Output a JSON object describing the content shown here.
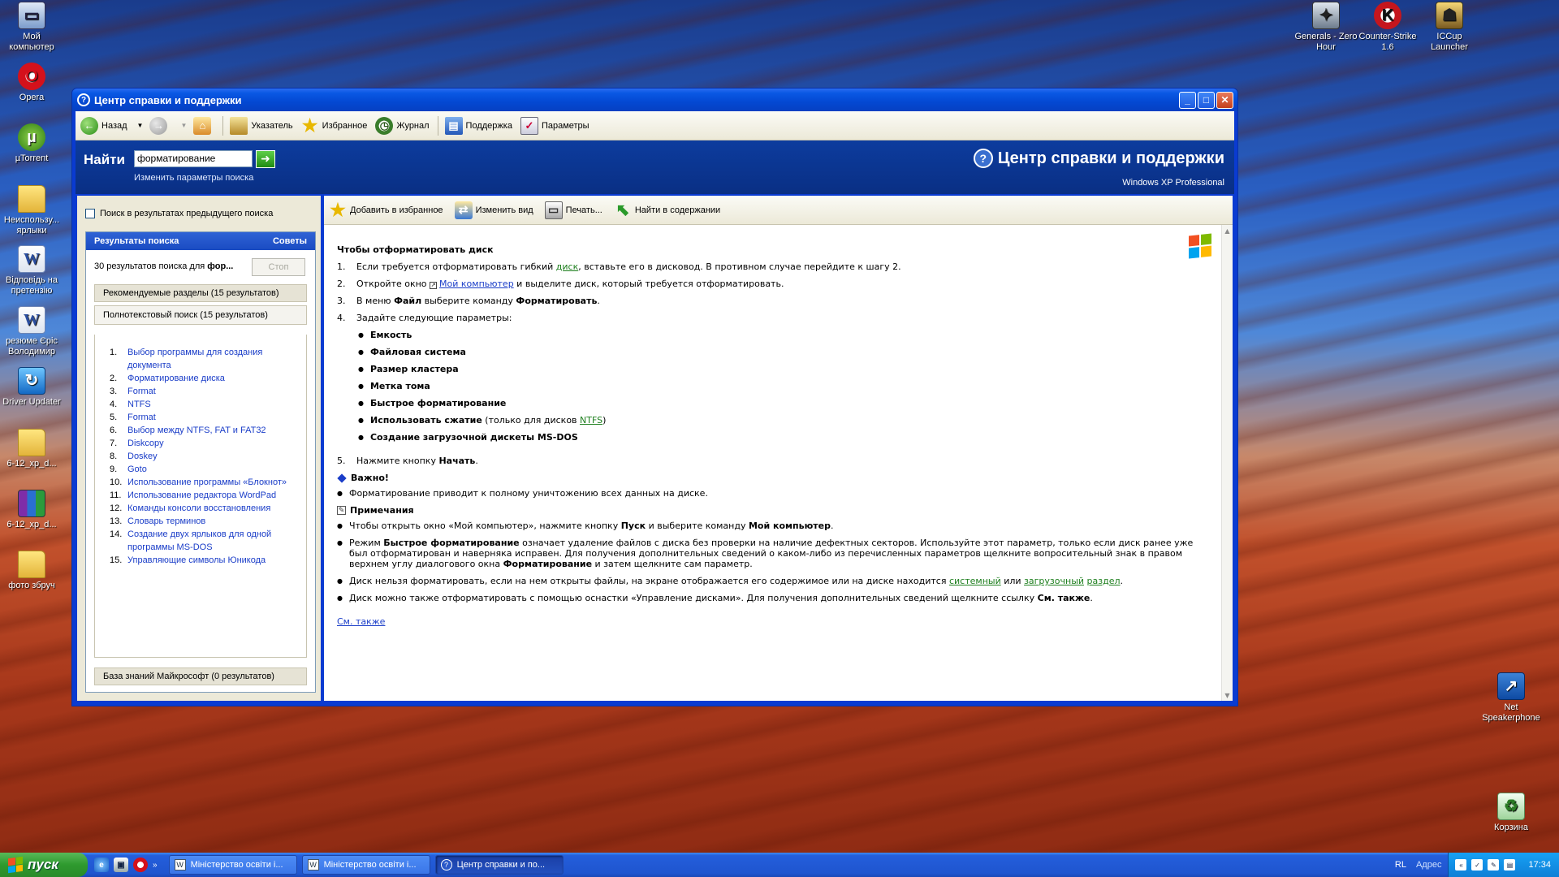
{
  "desktop": {
    "left_icons": [
      {
        "label": "Мой компьютер",
        "icon": "computer-icon"
      },
      {
        "label": "Opera",
        "icon": "opera-icon"
      },
      {
        "label": "µTorrent",
        "icon": "utorrent-icon"
      },
      {
        "label": "Неиспользу... ярлыки",
        "icon": "folder-icon"
      },
      {
        "label": "Відповідь на претензію",
        "icon": "word-document-icon"
      },
      {
        "label": "резюме Єріс Володимир",
        "icon": "word-document-icon"
      },
      {
        "label": "Driver Updater",
        "icon": "driver-updater-icon"
      },
      {
        "label": "6-12_xp_d...",
        "icon": "folder-icon"
      },
      {
        "label": "6-12_xp_d...",
        "icon": "winrar-archive-icon"
      },
      {
        "label": "фото збруч",
        "icon": "folder-icon"
      }
    ],
    "right_icons": [
      {
        "label": "Generals - Zero Hour",
        "icon": "generals-icon"
      },
      {
        "label": "Counter-Strike 1.6",
        "icon": "counter-strike-icon"
      },
      {
        "label": "ICCup Launcher",
        "icon": "iccup-icon"
      },
      {
        "label": "Net Speakerphone",
        "icon": "net-speakerphone-icon"
      },
      {
        "label": "Корзина",
        "icon": "recycle-bin-icon"
      }
    ]
  },
  "window": {
    "title": "Центр справки и поддержки",
    "toolbar": {
      "back": "Назад",
      "index": "Указатель",
      "favorites": "Избранное",
      "history": "Журнал",
      "support": "Поддержка",
      "options": "Параметры"
    },
    "header": {
      "find_label": "Найти",
      "search_value": "форматирование",
      "search_options": "Изменить параметры поиска",
      "title": "Центр справки и поддержки",
      "edition": "Windows XP Professional"
    },
    "left": {
      "checkbox_label": "Поиск в результатах предыдущего поиска",
      "results_title": "Результаты поиска",
      "tips": "Советы",
      "count_prefix": "30 результатов поиска для ",
      "count_query": "фор...",
      "stop_button": "Стоп",
      "cat_recommended": "Рекомендуемые разделы (15 результатов)",
      "cat_fulltext": "Полнотекстовый поиск (15 результатов)",
      "cat_kb": "База знаний Майкрософт (0 результатов)",
      "results": [
        {
          "n": "1.",
          "t": "Выбор программы для создания документа"
        },
        {
          "n": "2.",
          "t": "Форматирование диска"
        },
        {
          "n": "3.",
          "t": "Format"
        },
        {
          "n": "4.",
          "t": "NTFS"
        },
        {
          "n": "5.",
          "t": "Format"
        },
        {
          "n": "6.",
          "t": "Выбор между NTFS, FAT и FAT32"
        },
        {
          "n": "7.",
          "t": "Diskcopy"
        },
        {
          "n": "8.",
          "t": "Doskey"
        },
        {
          "n": "9.",
          "t": "Goto"
        },
        {
          "n": "10.",
          "t": "Использование программы «Блокнот»"
        },
        {
          "n": "11.",
          "t": "Использование редактора WordPad"
        },
        {
          "n": "12.",
          "t": "Команды консоли восстановления"
        },
        {
          "n": "13.",
          "t": "Словарь терминов"
        },
        {
          "n": "14.",
          "t": "Создание двух ярлыков для одной программы MS-DOS"
        },
        {
          "n": "15.",
          "t": "Управляющие символы Юникода"
        }
      ]
    },
    "cmdbar": {
      "add_fav": "Добавить в избранное",
      "change_view": "Изменить вид",
      "print": "Печать...",
      "find_contents": "Найти в содержании"
    },
    "article": {
      "title": "Чтобы отформатировать диск",
      "s1_n": "1.",
      "s1_a": "Если требуется отформатировать гибкий ",
      "s1_link": "диск",
      "s1_b": ", вставьте его в дисковод. В противном случае перейдите к шагу 2.",
      "s2_n": "2.",
      "s2_a": "Откройте окно ",
      "s2_link": "Мой компьютер",
      "s2_b": " и выделите диск, который требуется отформатировать.",
      "s3_n": "3.",
      "s3_a": "В меню ",
      "s3_b1": "Файл",
      "s3_c": " выберите команду ",
      "s3_b2": "Форматировать",
      "s3_d": ".",
      "s4_n": "4.",
      "s4_a": "Задайте следующие параметры:",
      "params": [
        "Емкость",
        "Файловая система",
        "Размер кластера",
        "Метка тома",
        "Быстрое форматирование"
      ],
      "param_compress": "Использовать сжатие",
      "param_compress_a": " (только для дисков ",
      "param_compress_link": "NTFS",
      "param_compress_b": ")",
      "param_boot": "Создание загрузочной дискеты MS-DOS",
      "s5_n": "5.",
      "s5_a": "Нажмите кнопку ",
      "s5_b": "Начать",
      "s5_c": ".",
      "important_title": "Важно!",
      "important_text": "Форматирование приводит к полному уничтожению всех данных на диске.",
      "notes_title": "Примечания",
      "n1_a": "Чтобы открыть окно «Мой компьютер», нажмите кнопку ",
      "n1_b1": "Пуск",
      "n1_c": " и выберите команду ",
      "n1_b2": "Мой компьютер",
      "n1_d": ".",
      "n2_a": "Режим ",
      "n2_b1": "Быстрое форматирование",
      "n2_c": " означает удаление файлов с диска без проверки на наличие дефектных секторов. Используйте этот параметр, только если диск ранее уже был отформатирован и наверняка исправен. Для получения дополнительных сведений о каком-либо из перечисленных параметров щелкните вопросительный знак в правом верхнем углу диалогового окна ",
      "n2_b2": "Форматирование",
      "n2_d": " и затем щелкните сам параметр.",
      "n3_a": "Диск нельзя форматировать, если на нем открыты файлы, на экране отображается его содержимое или на диске находится ",
      "n3_link1": "системный",
      "n3_b": " или ",
      "n3_link2": "загрузочный",
      "n3_c": " ",
      "n3_link3": "раздел",
      "n3_d": ".",
      "n4_a": "Диск можно также отформатировать с помощью оснастки «Управление дисками». Для получения дополнительных сведений щелкните ссылку ",
      "n4_b": "См. также",
      "n4_c": ".",
      "see_also": "См. также"
    }
  },
  "taskbar": {
    "start": "пуск",
    "tasks": [
      {
        "label": "Міністерство освіти і...",
        "active": false
      },
      {
        "label": "Міністерство освіти і...",
        "active": false
      },
      {
        "label": "Центр справки и по...",
        "active": true
      }
    ],
    "lang": "RL",
    "address": "Адрес",
    "clock": "17:34"
  }
}
